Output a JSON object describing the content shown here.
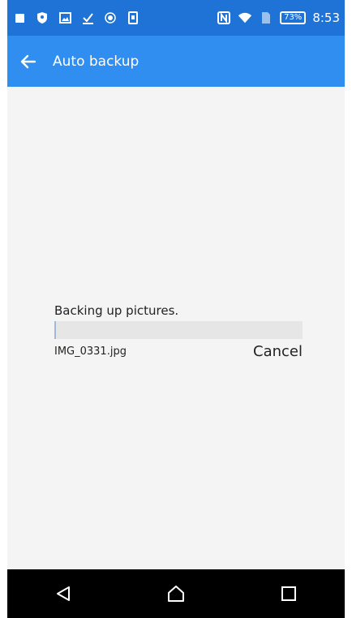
{
  "status_bar": {
    "battery_percent": "73%",
    "time": "8:53",
    "icons": [
      "square-notification-icon",
      "shield-icon",
      "image-icon",
      "download-check-icon",
      "record-icon",
      "phone-icon",
      "nfc-icon",
      "wifi-icon",
      "sim-icon",
      "battery-icon"
    ]
  },
  "app_bar": {
    "title": "Auto backup",
    "back_icon": "arrow-left-icon"
  },
  "progress": {
    "message": "Backing up pictures.",
    "file_name": "IMG_0331.jpg",
    "cancel_label": "Cancel",
    "fraction": 0.004
  },
  "nav_bar": {
    "icons": [
      "back-triangle-icon",
      "home-icon",
      "recents-icon"
    ]
  },
  "colors": {
    "status_bar": "#1f73d6",
    "app_bar": "#2f8ef0",
    "background": "#f4f4f4",
    "track": "#e6e6e6"
  }
}
